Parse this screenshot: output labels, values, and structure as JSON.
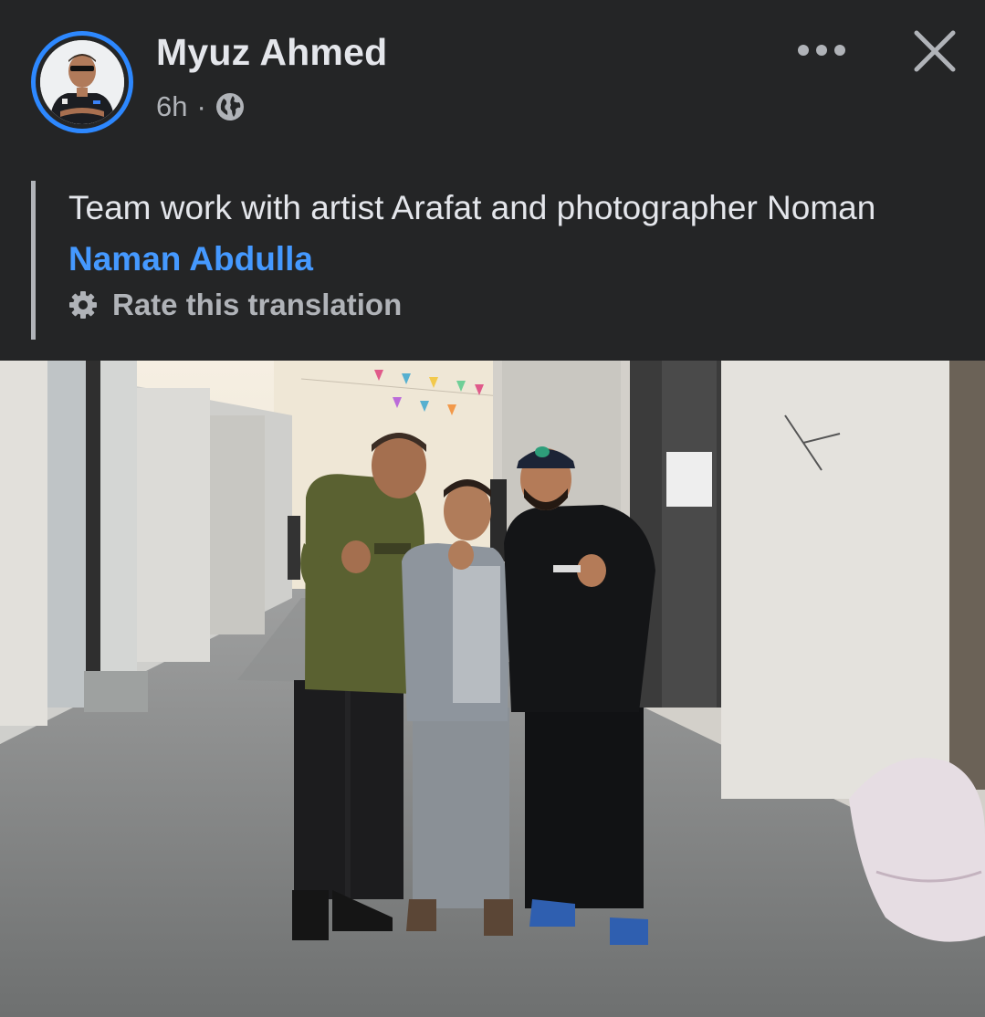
{
  "post": {
    "author": "Myuz Ahmed",
    "timestamp": "6h",
    "separator": "·",
    "audience_icon": "globe-icon",
    "text_before_mention": "Team work with artist Arafat and photographer Noman ",
    "mention": "Naman Abdulla",
    "rate_translation_label": "Rate this translation"
  },
  "header_actions": {
    "more_icon": "more-horizontal-icon",
    "close_icon": "close-icon"
  },
  "colors": {
    "background": "#242526",
    "text_primary": "#e4e6eb",
    "text_secondary": "#b0b3b8",
    "mention": "#4599ff",
    "avatar_ring": "#2d88ff"
  }
}
